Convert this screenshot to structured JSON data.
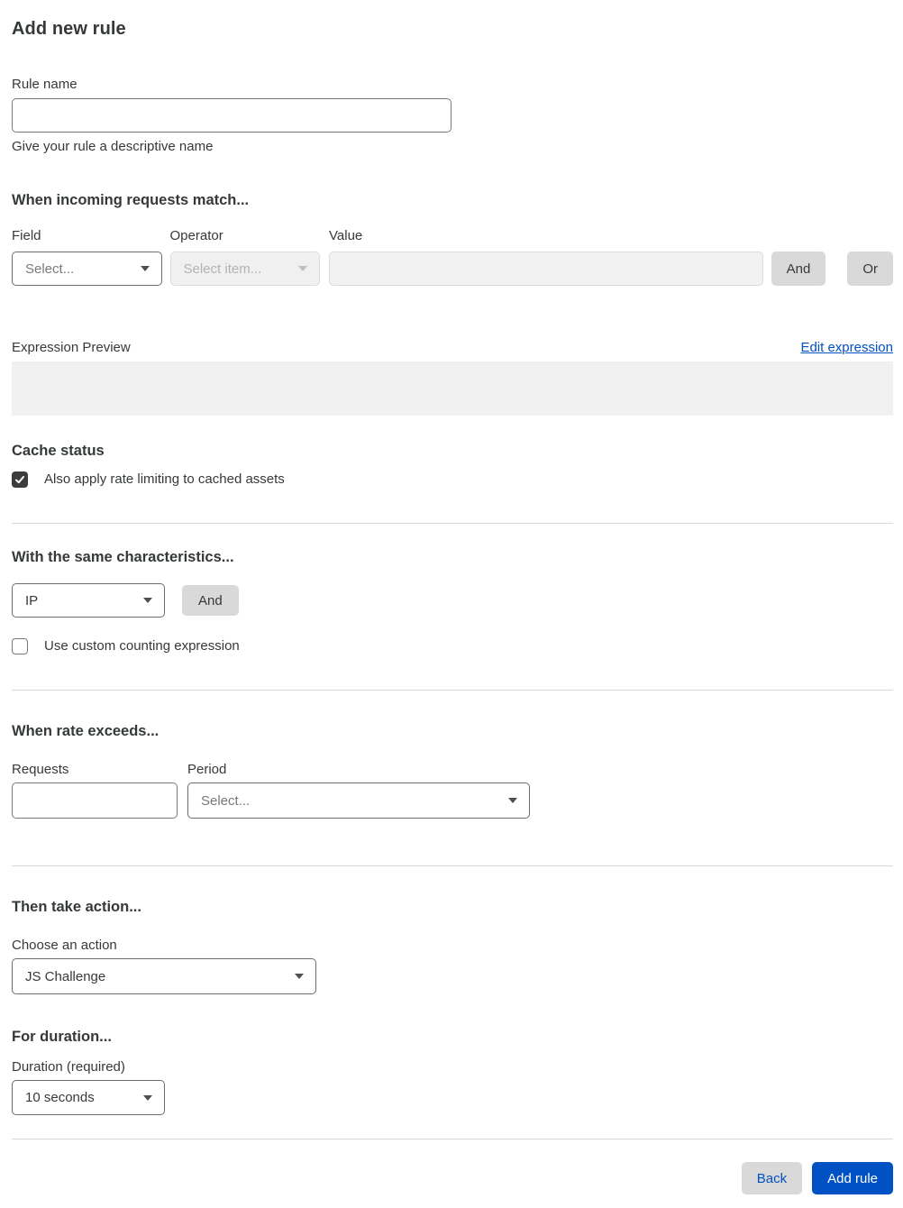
{
  "colors": {
    "accent_blue": "#0051c3",
    "text": "#36393a",
    "muted_text": "#797979",
    "disabled_bg": "#f0f0f0",
    "control_border": "#6d6d6d",
    "divider": "#d9d9d9",
    "gray_button_bg": "#d9d9d9",
    "preview_bg": "#f1f1f1",
    "checkbox_checked_bg": "#3c3c3c"
  },
  "page": {
    "title": "Add new rule"
  },
  "rule_name": {
    "label": "Rule name",
    "value": "",
    "helper": "Give your rule a descriptive name"
  },
  "match": {
    "heading": "When incoming requests match...",
    "field_label": "Field",
    "field_value": "Select...",
    "operator_label": "Operator",
    "operator_value": "Select item...",
    "value_label": "Value",
    "value_text": "",
    "and_label": "And",
    "or_label": "Or"
  },
  "expression": {
    "label": "Expression Preview",
    "edit_link": "Edit expression",
    "preview": ""
  },
  "cache": {
    "heading": "Cache status",
    "checkbox_label": "Also apply rate limiting to cached assets",
    "checked": true
  },
  "characteristics": {
    "heading": "With the same characteristics...",
    "value": "IP",
    "and_label": "And",
    "checkbox_label": "Use custom counting expression",
    "checked": false
  },
  "rate": {
    "heading": "When rate exceeds...",
    "requests_label": "Requests",
    "requests_value": "",
    "period_label": "Period",
    "period_value": "Select..."
  },
  "action": {
    "heading": "Then take action...",
    "label": "Choose an action",
    "value": "JS Challenge"
  },
  "duration": {
    "heading": "For duration...",
    "label": "Duration (required)",
    "value": "10 seconds"
  },
  "footer": {
    "back_label": "Back",
    "submit_label": "Add rule"
  }
}
